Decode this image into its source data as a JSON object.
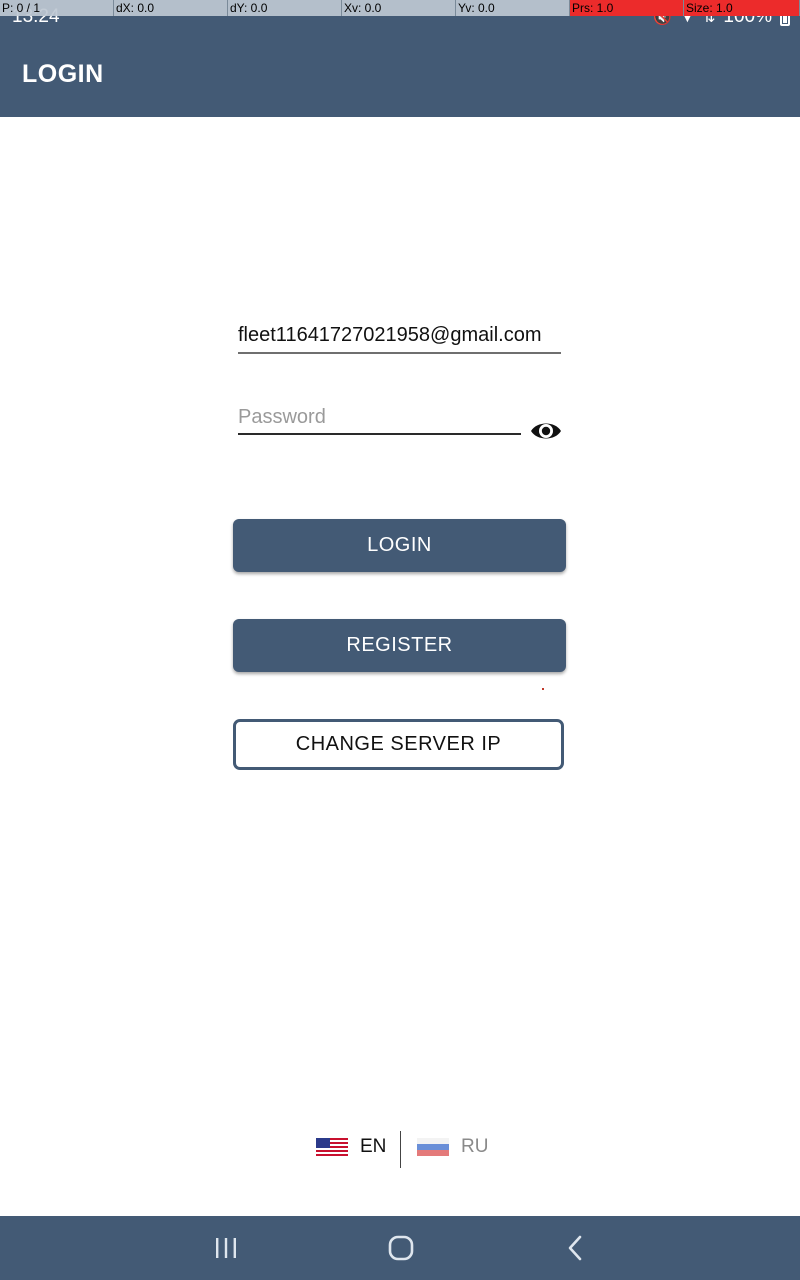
{
  "debug_overlay": {
    "cells": [
      "P: 0 / 1",
      "dX: 0.0",
      "dY: 0.0",
      "Xv: 0.0",
      "Yv: 0.0",
      "Prs: 1.0",
      "Size: 1.0"
    ],
    "highlight_color": "#ec2b2b"
  },
  "status_bar": {
    "time": "13:24",
    "battery": "100%",
    "icons": [
      "mute-icon",
      "wifi-icon",
      "data-arrows-icon",
      "battery-icon"
    ]
  },
  "app_bar": {
    "title": "LOGIN"
  },
  "form": {
    "email_value": "fleet11641727021958@gmail.com",
    "password_placeholder": "Password",
    "password_value": "",
    "toggle_icon": "eye-icon"
  },
  "buttons": {
    "login": "LOGIN",
    "register": "REGISTER",
    "change_server_ip": "CHANGE SERVER IP"
  },
  "language": {
    "selected": "EN",
    "options": [
      {
        "code": "EN",
        "icon": "us-flag-icon"
      },
      {
        "code": "RU",
        "icon": "ru-flag-icon"
      }
    ]
  },
  "nav_bar": {
    "icons": [
      "recents-icon",
      "home-icon",
      "back-icon"
    ]
  },
  "colors": {
    "primary": "#435a75",
    "background": "#ffffff",
    "inactive_text": "#8a8a8a"
  }
}
